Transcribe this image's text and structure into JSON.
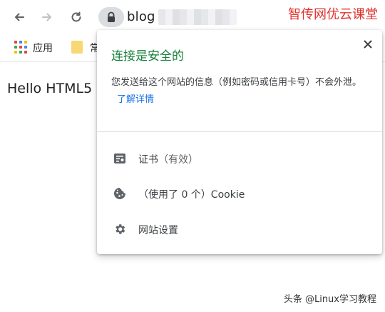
{
  "browser": {
    "url_visible": "blog",
    "watermark_top": "智传网优云课堂"
  },
  "bookmarks": {
    "apps_label": "应用",
    "folder_label": "常"
  },
  "page": {
    "content_text": "Hello HTML5"
  },
  "popup": {
    "title": "连接是安全的",
    "description": "您发送给这个网站的信息（例如密码或信用卡号）不会外泄。",
    "learn_more": "了解详情",
    "certificate_label": "证书",
    "certificate_status": "（有效）",
    "cookie_label": "（使用了 0 个）Cookie",
    "site_settings_label": "网站设置",
    "title_color": "#188038",
    "link_color": "#1a73e8"
  },
  "footer": {
    "watermark_bottom": "头条 @Linux学习教程"
  }
}
